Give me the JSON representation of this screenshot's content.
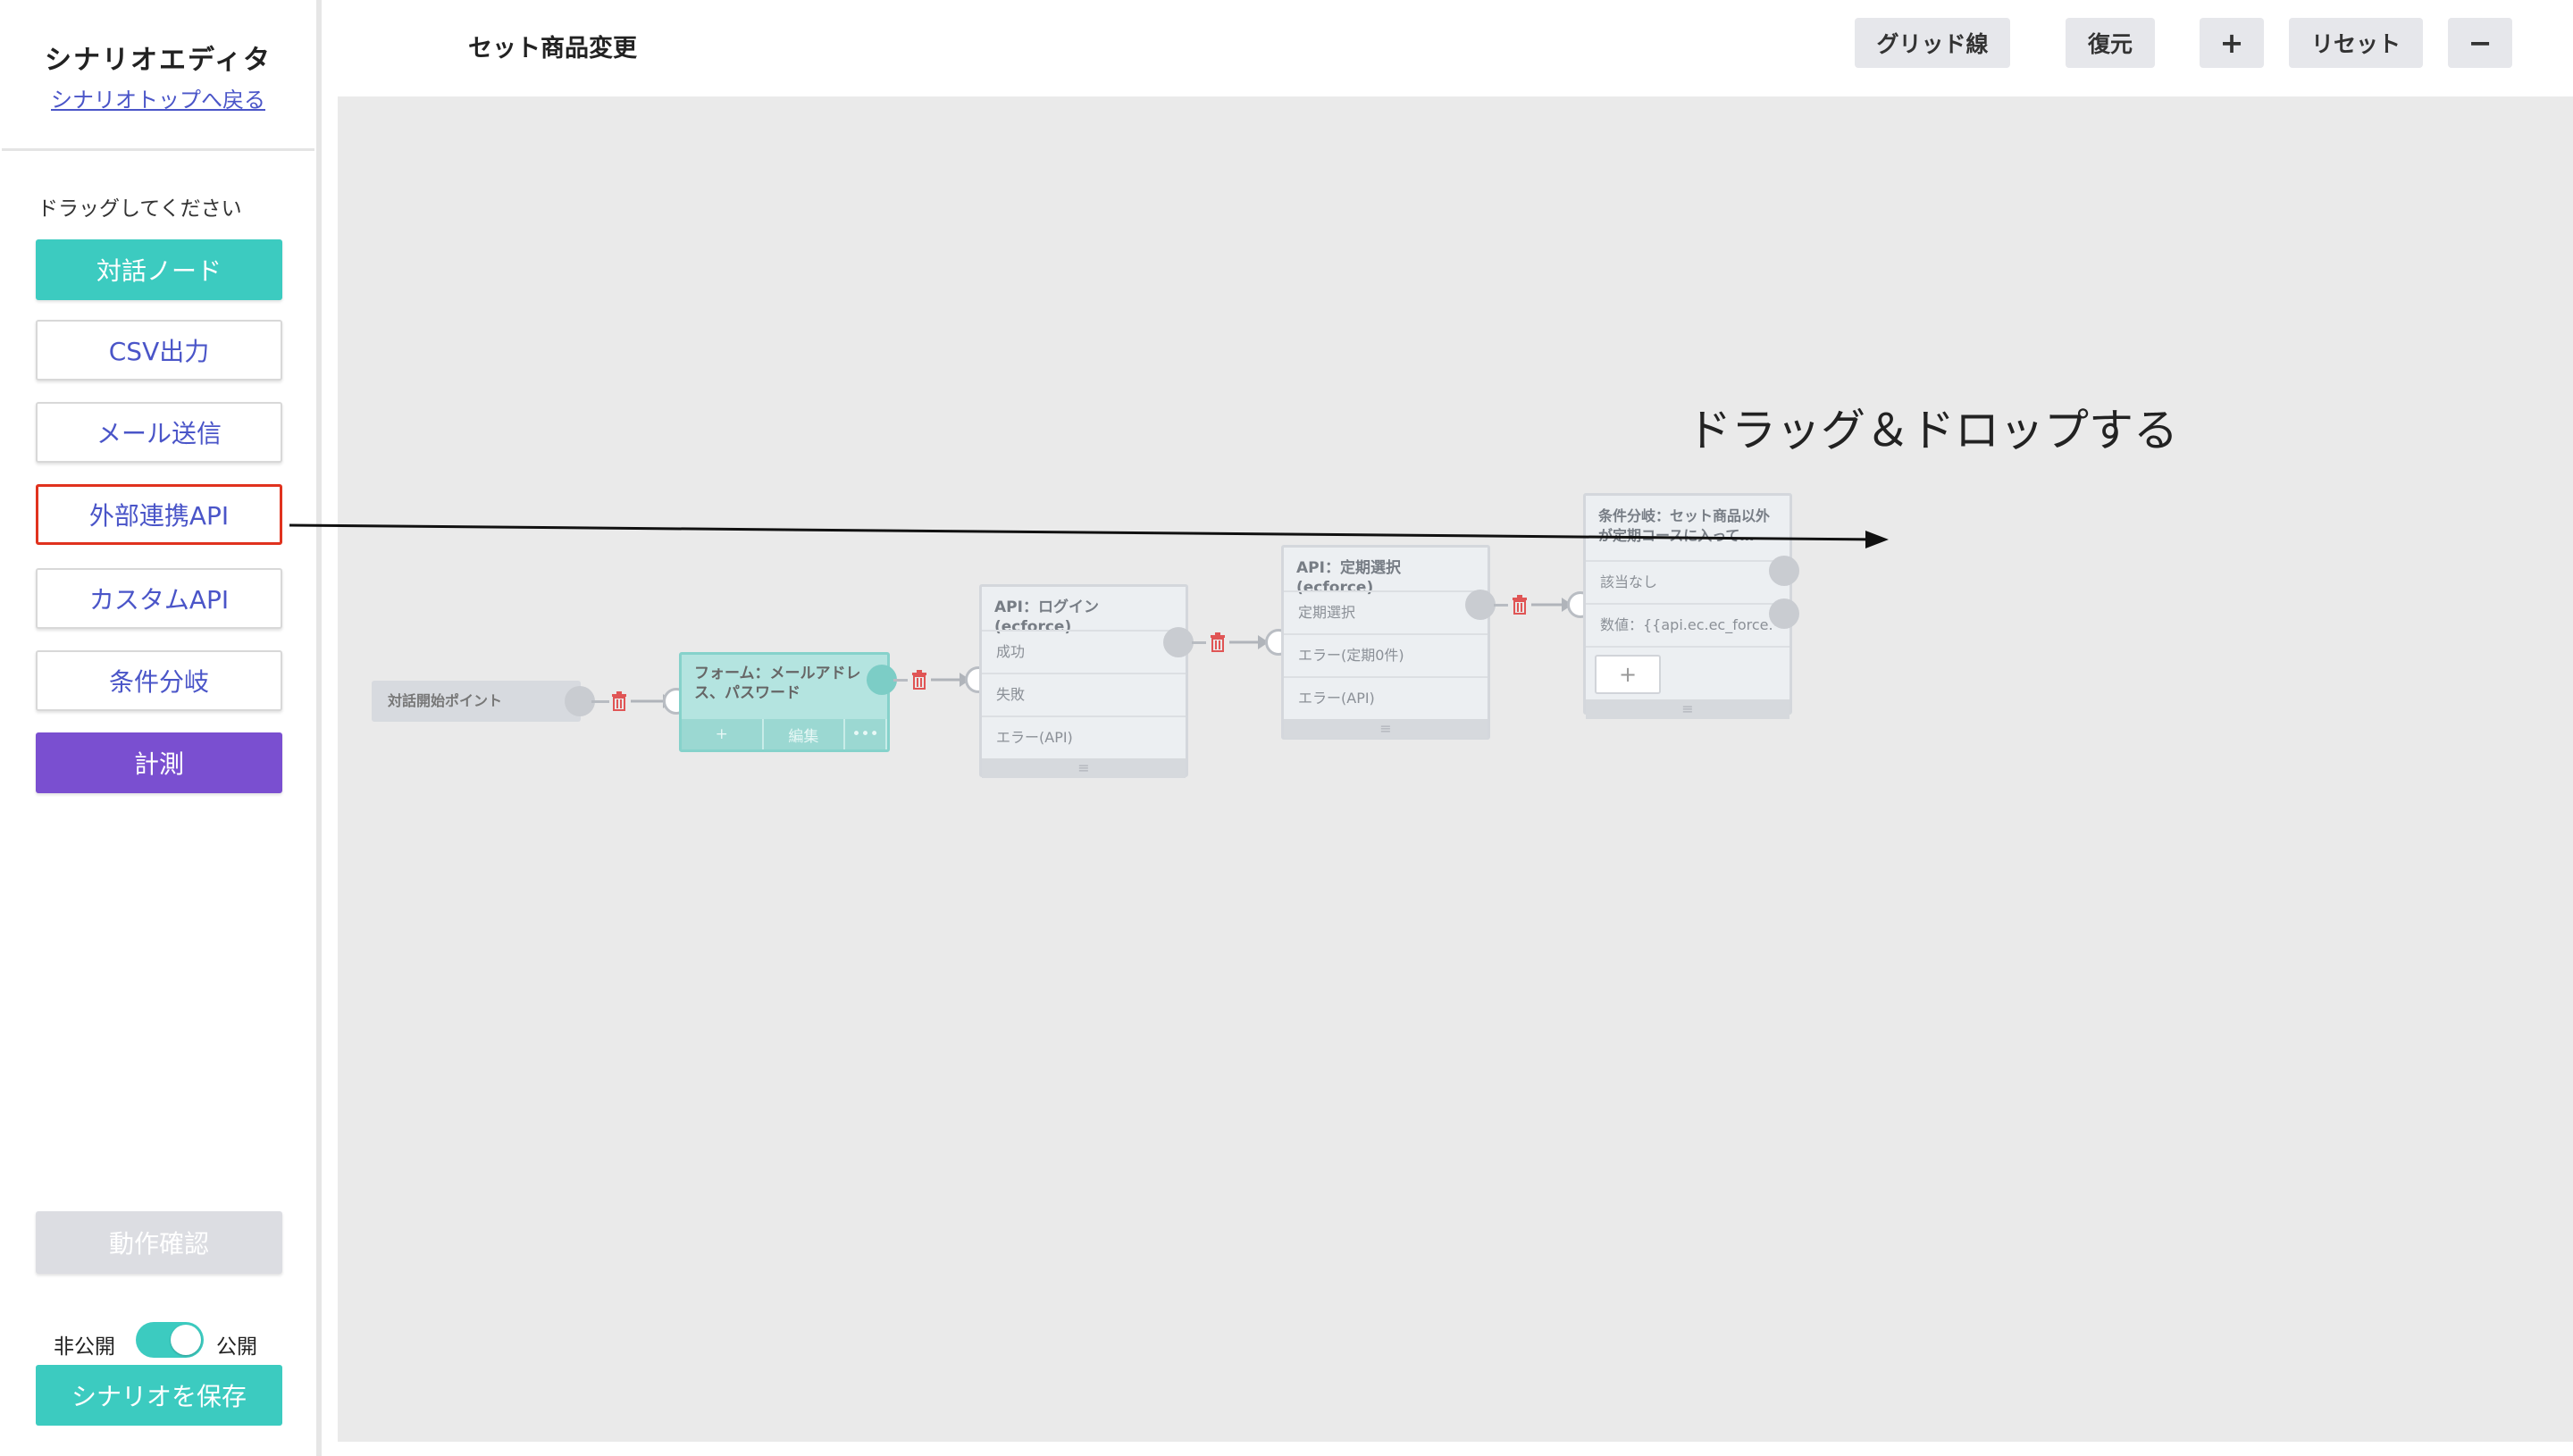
{
  "sidebar": {
    "title": "シナリオエディタ",
    "back_link": "シナリオトップへ戻る",
    "hint": "ドラッグしてください",
    "palette": [
      {
        "label": "対話ノード"
      },
      {
        "label": "CSV出力"
      },
      {
        "label": "メール送信"
      },
      {
        "label": "外部連携API"
      },
      {
        "label": "カスタムAPI"
      },
      {
        "label": "条件分岐"
      },
      {
        "label": "計測"
      }
    ],
    "test_button": "動作確認",
    "toggle": {
      "off_label": "非公開",
      "on_label": "公開",
      "state": "on"
    },
    "save_button": "シナリオを保存"
  },
  "header": {
    "title": "セット商品変更",
    "buttons": {
      "grid": "グリッド線",
      "restore": "復元",
      "zoom_in": "+",
      "reset": "リセット",
      "zoom_out": "−"
    }
  },
  "canvas": {
    "annotation": "ドラッグ＆ドロップする",
    "start_node": {
      "label": "対話開始ポイント"
    },
    "form_node": {
      "title": "フォーム：メールアドレス、パスワード",
      "actions": [
        "+",
        "編集",
        "•••"
      ]
    },
    "api_login_node": {
      "title": "API：ログイン(ecforce)",
      "rows": [
        "成功",
        "失敗",
        "エラー(API)"
      ],
      "footer": "≡"
    },
    "api_regular_node": {
      "title": "API：定期選択(ecforce)",
      "rows": [
        "定期選択",
        "エラー(定期0件)",
        "エラー(API)"
      ],
      "footer": "≡"
    },
    "branch_node": {
      "title": "条件分岐：セット商品以外が定期コースに入って…",
      "rows": [
        "該当なし",
        "数値：{{api.ec.ec_force.·"
      ],
      "add": "+",
      "footer": "≡"
    }
  },
  "colors": {
    "accent_teal": "#3ccbc0",
    "accent_purple": "#7a4fd0",
    "link_blue": "#4a55c8",
    "highlight_red": "#e0321e",
    "canvas_bg": "#eaeaea"
  }
}
